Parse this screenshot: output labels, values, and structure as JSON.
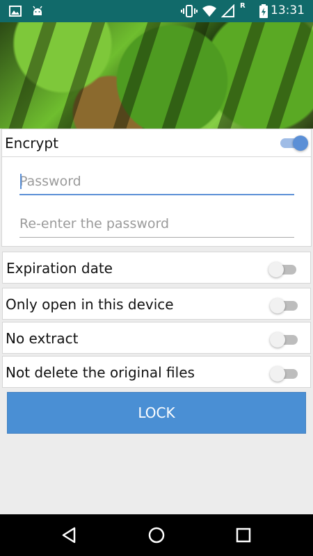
{
  "status_bar": {
    "time": "13:31",
    "left_icons": [
      "image-icon",
      "android-icon"
    ],
    "right_icons": [
      "vibrate-icon",
      "wifi-icon",
      "signal-icon",
      "battery-icon"
    ],
    "signal_badge": "R",
    "bg_color": "#116a6a"
  },
  "hero": {
    "description_icon": "hero-image"
  },
  "encrypt": {
    "label": "Encrypt",
    "enabled": true,
    "password_placeholder": "Password",
    "reenter_placeholder": "Re-enter the password"
  },
  "options": [
    {
      "label": "Expiration date",
      "enabled": false
    },
    {
      "label": "Only open in this device",
      "enabled": false
    },
    {
      "label": "No extract",
      "enabled": false
    },
    {
      "label": "Not delete the original files",
      "enabled": false
    }
  ],
  "lock_button": {
    "label": "LOCK",
    "color": "#4a8fd4"
  },
  "nav_bar": {
    "icons": [
      "back-icon",
      "home-icon",
      "recents-icon"
    ]
  }
}
